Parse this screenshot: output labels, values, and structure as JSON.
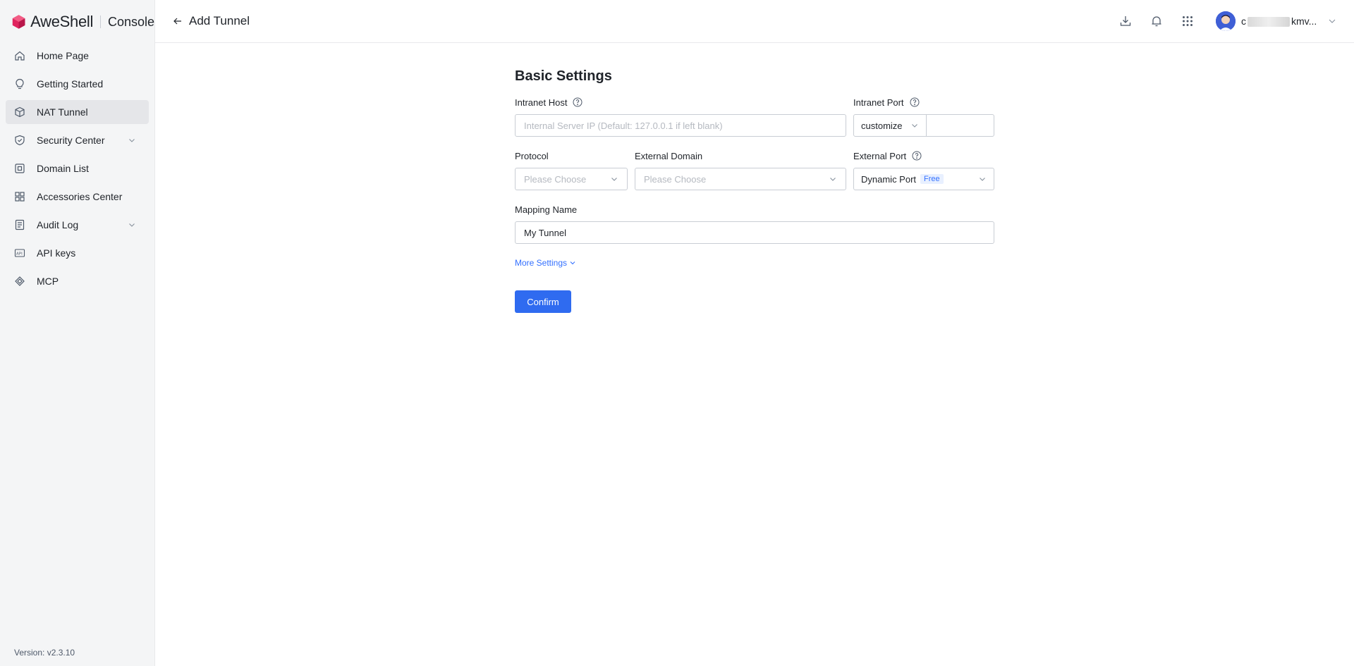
{
  "brand": {
    "name": "AweShell",
    "console": "Console",
    "logo_color": "#e0245e"
  },
  "sidebar": {
    "items": [
      {
        "label": "Home Page",
        "icon": "home-icon",
        "active": false,
        "expandable": false
      },
      {
        "label": "Getting Started",
        "icon": "lightbulb-icon",
        "active": false,
        "expandable": false
      },
      {
        "label": "NAT Tunnel",
        "icon": "cube-icon",
        "active": true,
        "expandable": false
      },
      {
        "label": "Security Center",
        "icon": "shield-icon",
        "active": false,
        "expandable": true
      },
      {
        "label": "Domain List",
        "icon": "domain-icon",
        "active": false,
        "expandable": false
      },
      {
        "label": "Accessories Center",
        "icon": "grid-icon",
        "active": false,
        "expandable": false
      },
      {
        "label": "Audit Log",
        "icon": "log-icon",
        "active": false,
        "expandable": true
      },
      {
        "label": "API keys",
        "icon": "api-icon",
        "active": false,
        "expandable": false
      },
      {
        "label": "MCP",
        "icon": "mcp-icon",
        "active": false,
        "expandable": false
      }
    ],
    "version": "Version: v2.3.10"
  },
  "header": {
    "title": "Add Tunnel",
    "user": {
      "name_start": "c",
      "name_end": "kmv..."
    }
  },
  "form": {
    "section_title": "Basic Settings",
    "intranet_host": {
      "label": "Intranet Host",
      "placeholder": "Internal Server IP (Default: 127.0.0.1 if left blank)"
    },
    "intranet_port": {
      "label": "Intranet Port",
      "mode": "customize",
      "value": ""
    },
    "protocol": {
      "label": "Protocol",
      "placeholder": "Please Choose"
    },
    "external_domain": {
      "label": "External Domain",
      "placeholder": "Please Choose"
    },
    "external_port": {
      "label": "External Port",
      "value": "Dynamic Port",
      "tag": "Free"
    },
    "mapping_name": {
      "label": "Mapping Name",
      "value": "My Tunnel"
    },
    "more_settings": "More Settings",
    "confirm": "Confirm"
  },
  "colors": {
    "primary": "#2f6bf0",
    "link": "#3370ff",
    "sidebar_bg": "#f4f5f6"
  }
}
